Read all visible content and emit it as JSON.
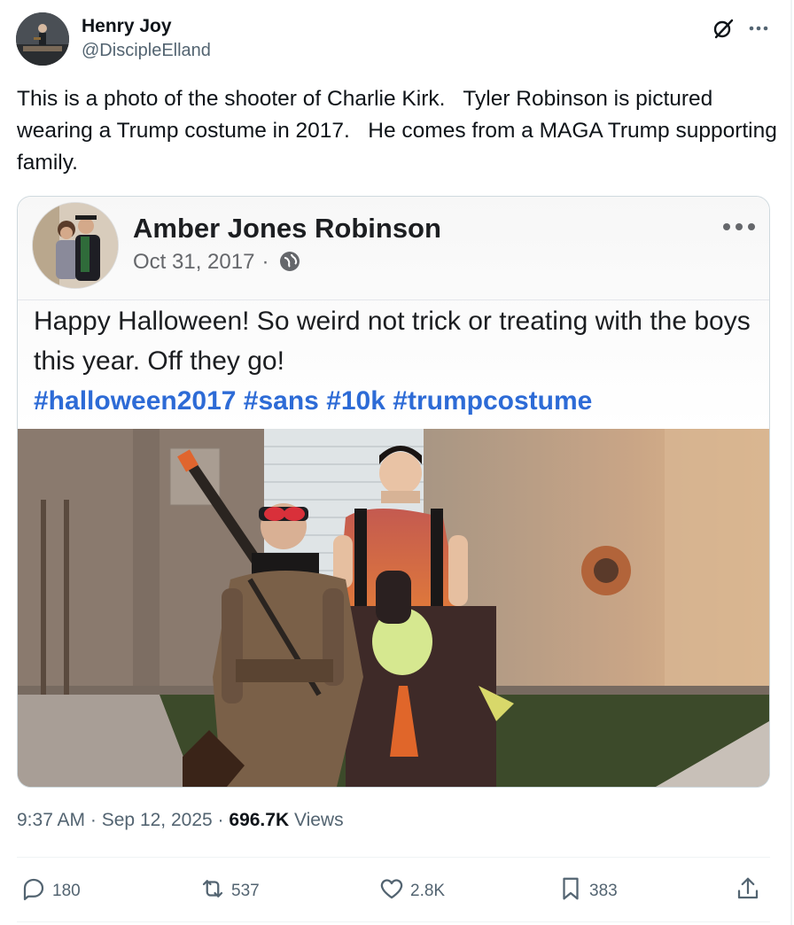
{
  "author": {
    "name": "Henry Joy",
    "handle": "@DiscipleElland"
  },
  "header_icons": [
    "grok-icon",
    "more-icon"
  ],
  "tweet": {
    "text": "This is a photo of the shooter of Charlie Kirk.   Tyler Robinson is pictured wearing a Trump costume in 2017.   He comes from a MAGA Trump supporting family."
  },
  "embedded_post": {
    "name": "Amber Jones Robinson",
    "date": "Oct 31, 2017",
    "separator": "·",
    "text": "Happy Halloween! So weird not trick or treating with the boys this year. Off they go!",
    "hashtags": "#halloween2017 #sans #10k #trumpcostume"
  },
  "meta": {
    "time": "9:37 AM",
    "sep1": "·",
    "date": "Sep 12, 2025",
    "sep2": "·",
    "views_count": "696.7K",
    "views_label": "Views"
  },
  "actions": {
    "replies": "180",
    "reposts": "537",
    "likes": "2.8K",
    "bookmarks": "383"
  },
  "colors": {
    "text_primary": "#0f1419",
    "text_secondary": "#536471",
    "hashtag_blue": "#2d6bd6",
    "border": "#cfd9de"
  }
}
